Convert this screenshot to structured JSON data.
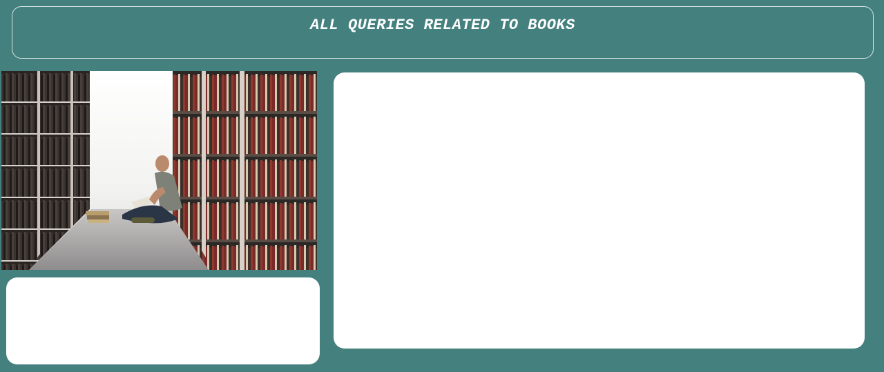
{
  "header": {
    "title": "ALL QUERIES RELATED TO BOOKS"
  },
  "colors": {
    "background": "#43807e",
    "panel": "#ffffff",
    "header_border": "#d9e6e5",
    "title_text": "#ffffff"
  },
  "photo": {
    "subject": "man-reading-in-library-aisle"
  },
  "icons": [
    "library-photo"
  ]
}
